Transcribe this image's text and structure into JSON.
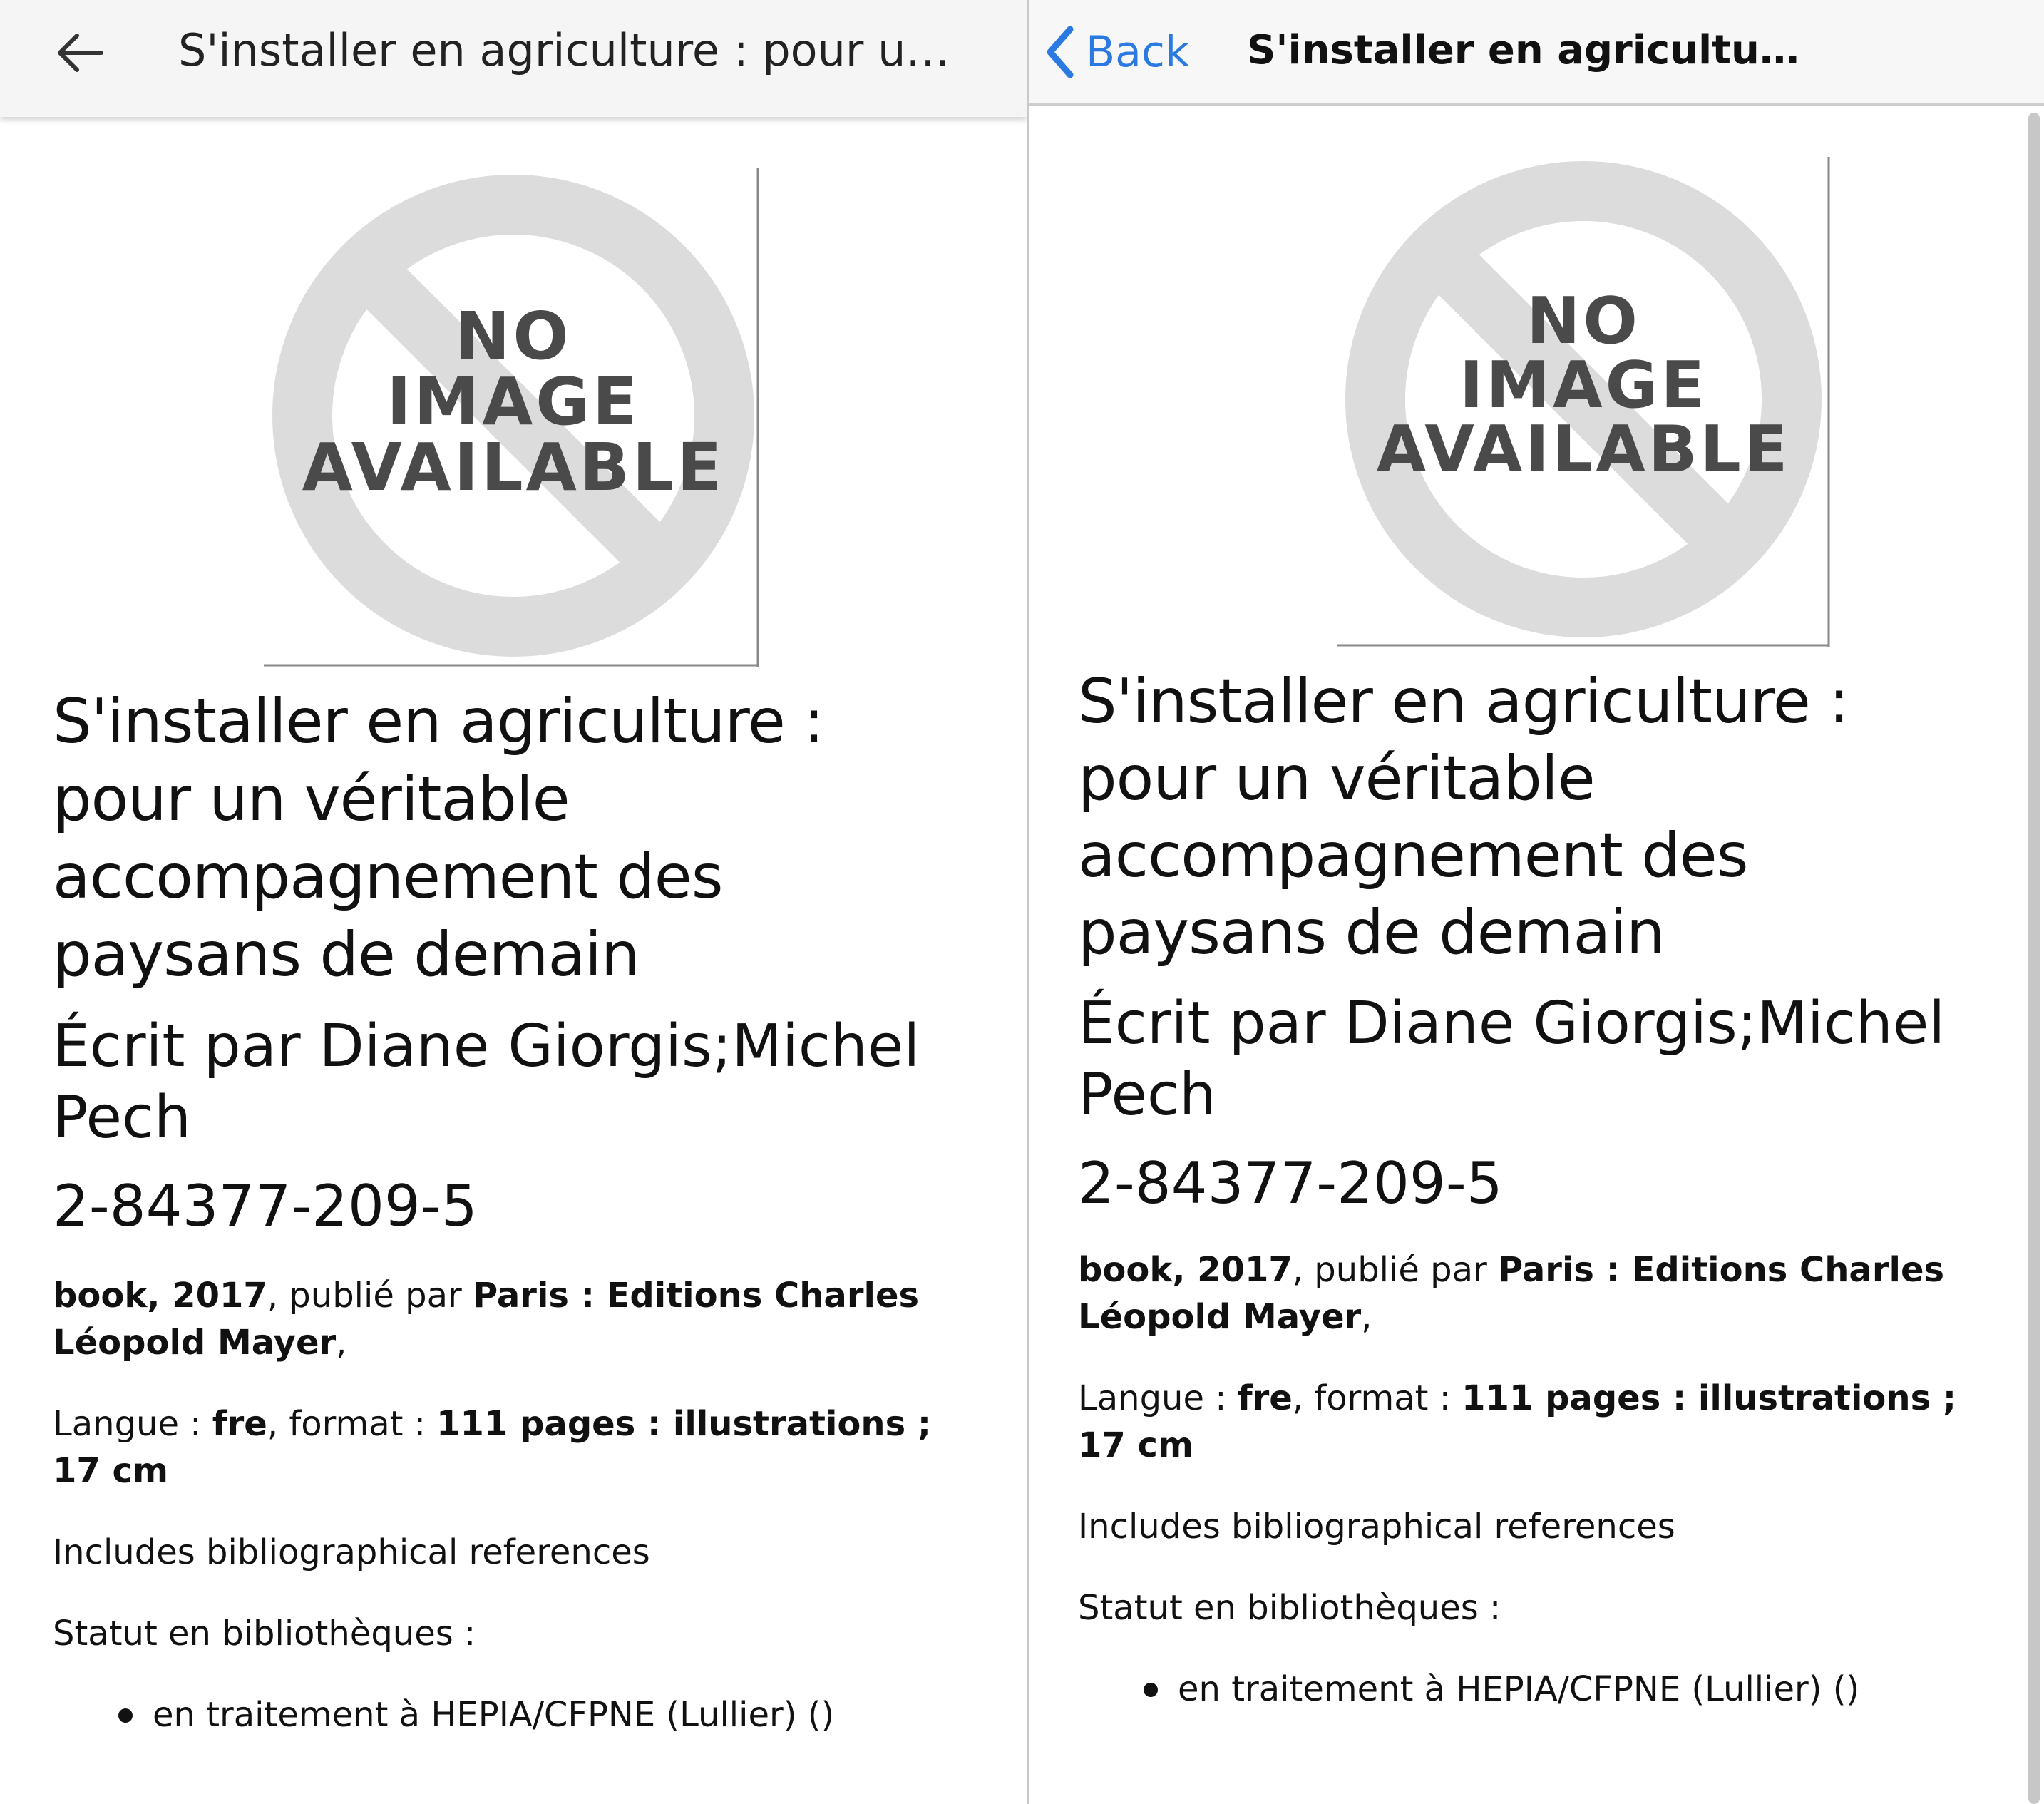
{
  "left": {
    "appbar": {
      "back_icon": "arrow-back-icon",
      "title": "S'installer en agriculture : pour un ..."
    },
    "image": {
      "line1": "NO",
      "line2": "IMAGE",
      "line3": "AVAILABLE"
    },
    "book": {
      "title": "S'installer en agriculture : pour un véritable accompagnement des paysans de demain",
      "author": "Écrit par Diane Giorgis;Michel Pech",
      "isbn": "2-84377-209-5"
    },
    "meta": {
      "type_year": "book, 2017",
      "published_by_label": ", publié par ",
      "publisher": "Paris : Editions Charles Léopold Mayer",
      "trailing": ",",
      "language_label": "Langue : ",
      "language": "fre",
      "format_label": ", format : ",
      "format": "111 pages : illustrations ; 17 cm"
    },
    "notes": "Includes bibliographical references",
    "status_label": "Statut en bibliothèques :",
    "status_items": [
      "en traitement à HEPIA/CFPNE (Lullier) ()"
    ]
  },
  "right": {
    "appbar": {
      "back_icon": "chevron-left-icon",
      "back_label": "Back",
      "title": "S'installer en agriculture : p..."
    },
    "image": {
      "line1": "NO",
      "line2": "IMAGE",
      "line3": "AVAILABLE"
    },
    "book": {
      "title": "S'installer en agriculture : pour un véritable accompagnement des paysans de demain",
      "author": "Écrit par Diane Giorgis;Michel Pech",
      "isbn": "2-84377-209-5"
    },
    "meta": {
      "type_year": "book, 2017",
      "published_by_label": ", publié par ",
      "publisher": "Paris : Editions Charles Léopold Mayer",
      "trailing": ",",
      "language_label": "Langue : ",
      "language": "fre",
      "format_label": ", format : ",
      "format": "111 pages : illustrations ; 17 cm"
    },
    "notes": "Includes bibliographical references",
    "status_label": "Statut en bibliothèques :",
    "status_items": [
      "en traitement à HEPIA/CFPNE (Lullier) ()"
    ]
  },
  "colors": {
    "ios_accent": "#2a7ae2",
    "placeholder_gray": "#dcdcdc",
    "placeholder_text": "#4a4a4a"
  }
}
